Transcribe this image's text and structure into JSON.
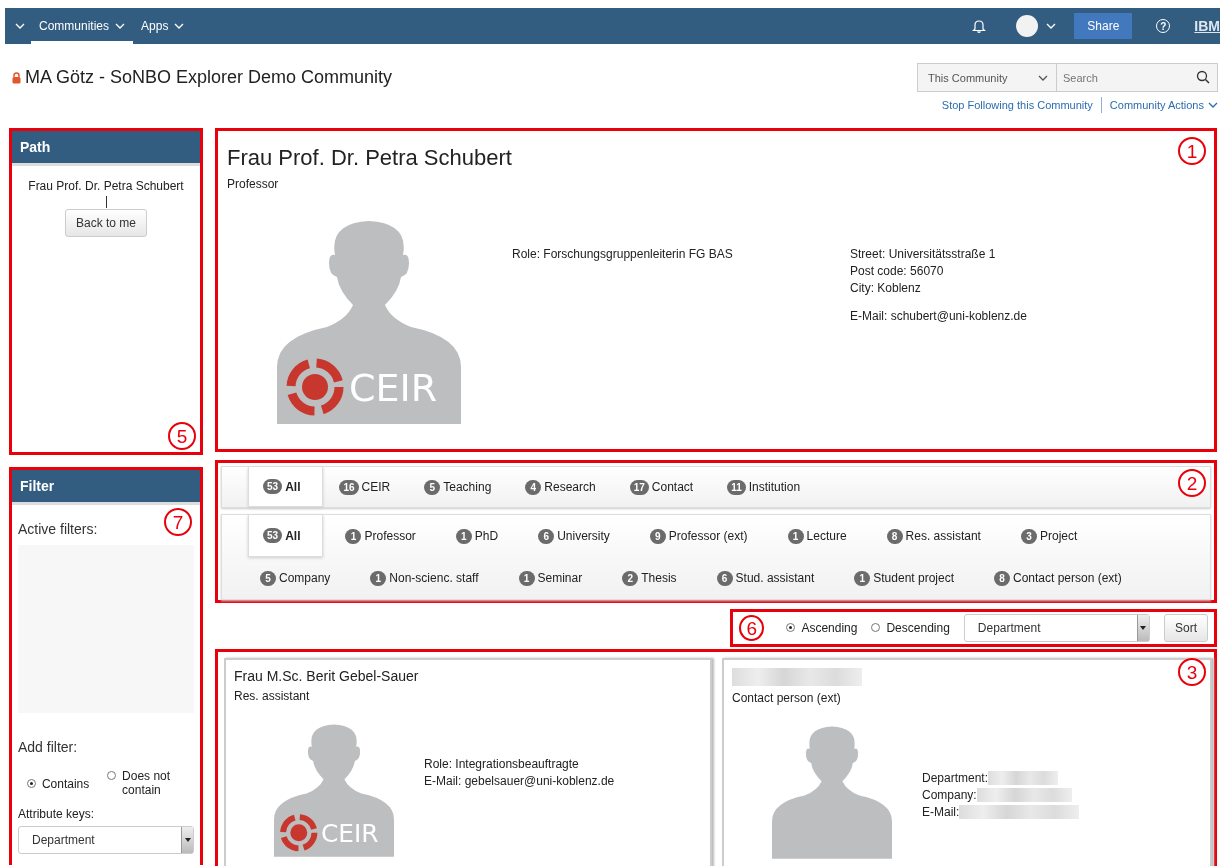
{
  "nav": {
    "items": [
      {
        "label": "Communities",
        "selected": true
      },
      {
        "label": "Apps",
        "selected": false
      }
    ],
    "share": "Share",
    "help": "?",
    "logo": "IBM"
  },
  "header": {
    "title": "MA Götz - SoNBO Explorer Demo Community",
    "scope": "This Community",
    "search_placeholder": "Search",
    "links": [
      "Stop Following this Community",
      "Community Actions"
    ]
  },
  "path": {
    "title": "Path",
    "annotation": "5",
    "items": [
      "Frau Prof. Dr. Petra Schubert"
    ],
    "button": "Back to me"
  },
  "filter": {
    "title": "Filter",
    "annotation": "7",
    "active_label": "Active filters:",
    "add_label": "Add filter:",
    "options": [
      {
        "label": "Contains",
        "selected": true
      },
      {
        "label": "Does not contain",
        "selected": false
      }
    ],
    "keys_label": "Attribute keys:",
    "keys_value": "Department"
  },
  "profile": {
    "annotation": "1",
    "name": "Frau Prof. Dr. Petra Schubert",
    "type": "Professor",
    "avatar_logo": "CEIR",
    "columns": [
      {
        "groups": [
          [
            "Role: Forschungsgruppenleiterin FG BAS"
          ]
        ]
      },
      {
        "groups": [
          [
            "Street: Universitätsstraße 1",
            "Post code: 56070",
            "City: Koblenz"
          ],
          [
            "E-Mail: schubert@uni-koblenz.de"
          ]
        ]
      }
    ]
  },
  "categories": {
    "annotation": "2",
    "bars": [
      [
        {
          "count": "53",
          "label": "All",
          "selected": true
        },
        {
          "count": "16",
          "label": "CEIR",
          "selected": false
        },
        {
          "count": "5",
          "label": "Teaching",
          "selected": false
        },
        {
          "count": "4",
          "label": "Research",
          "selected": false
        },
        {
          "count": "17",
          "label": "Contact",
          "selected": false
        },
        {
          "count": "11",
          "label": "Institution",
          "selected": false
        }
      ],
      [
        {
          "count": "53",
          "label": "All",
          "selected": true
        },
        {
          "count": "1",
          "label": "Professor",
          "selected": false
        },
        {
          "count": "1",
          "label": "PhD",
          "selected": false
        },
        {
          "count": "6",
          "label": "University",
          "selected": false
        },
        {
          "count": "9",
          "label": "Professor (ext)",
          "selected": false
        },
        {
          "count": "1",
          "label": "Lecture",
          "selected": false
        },
        {
          "count": "8",
          "label": "Res. assistant",
          "selected": false
        },
        {
          "count": "3",
          "label": "Project",
          "selected": false
        },
        {
          "count": "5",
          "label": "Company",
          "selected": false
        },
        {
          "count": "1",
          "label": "Non-scienc. staff",
          "selected": false
        },
        {
          "count": "1",
          "label": "Seminar",
          "selected": false
        },
        {
          "count": "2",
          "label": "Thesis",
          "selected": false
        },
        {
          "count": "6",
          "label": "Stud. assistant",
          "selected": false
        },
        {
          "count": "1",
          "label": "Student project",
          "selected": false
        },
        {
          "count": "8",
          "label": "Contact person (ext)",
          "selected": false
        }
      ]
    ]
  },
  "sort": {
    "annotation": "6",
    "options": [
      {
        "label": "Ascending",
        "selected": true
      },
      {
        "label": "Descending",
        "selected": false
      }
    ],
    "field": "Department",
    "button": "Sort"
  },
  "results": {
    "annotation": "3",
    "cards": [
      {
        "name": "Frau M.Sc. Berit Gebel-Sauer",
        "type": "Res. assistant",
        "avatar_logo": "CEIR",
        "fields": [
          {
            "label": "Role: Integrationsbeauftragte",
            "redacted": false
          },
          {
            "label": "E-Mail: gebelsauer@uni-koblenz.de",
            "redacted": false
          }
        ]
      },
      {
        "name_redacted": true,
        "type": "Contact person (ext)",
        "fields": [
          {
            "label": "Department:",
            "redacted": true
          },
          {
            "label": "Company:",
            "redacted": true
          },
          {
            "label": "E-Mail:",
            "redacted": true
          }
        ]
      }
    ]
  }
}
